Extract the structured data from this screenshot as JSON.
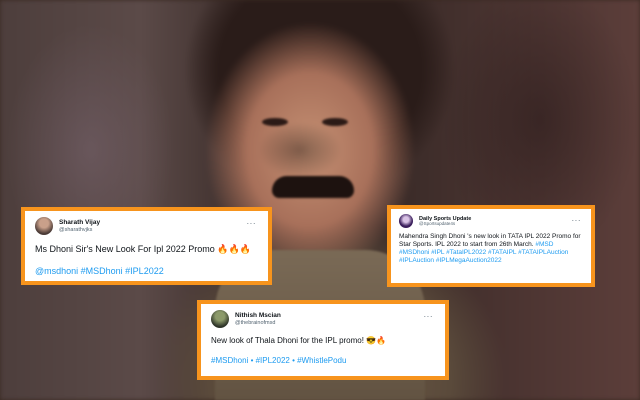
{
  "tweets": [
    {
      "name": "Sharath Vijay",
      "handle": "@sharathvjks",
      "more": "···",
      "text": "Ms Dhoni Sir's New Look For Ipl 2022 Promo",
      "emoji": "🔥🔥🔥",
      "tags": "@msdhoni #MSDhoni #IPL2022"
    },
    {
      "name": "Daily Sports Update",
      "handle": "@Sportsupdate4s",
      "more": "···",
      "text": "Mahendra Singh Dhoni 's new look in TATA IPL 2022 Promo for Star Sports. IPL 2022 to start from 26th March.",
      "tags": "#MSD #MSDhoni #IPL #TataIPL2022 #TATAIPL #TATAIPLAuction #IPLAuction #IPLMegaAuction2022"
    },
    {
      "name": "Nithish Mscian",
      "handle": "@thebrainofmsd",
      "more": "···",
      "text": "New look of Thala Dhoni for the IPL promo!",
      "emoji": "😎🔥",
      "tags": "#MSDhoni • #IPL2022 • #WhistlePodu"
    }
  ],
  "colors": {
    "frame": "#f7941d",
    "link": "#1d9bf0"
  }
}
